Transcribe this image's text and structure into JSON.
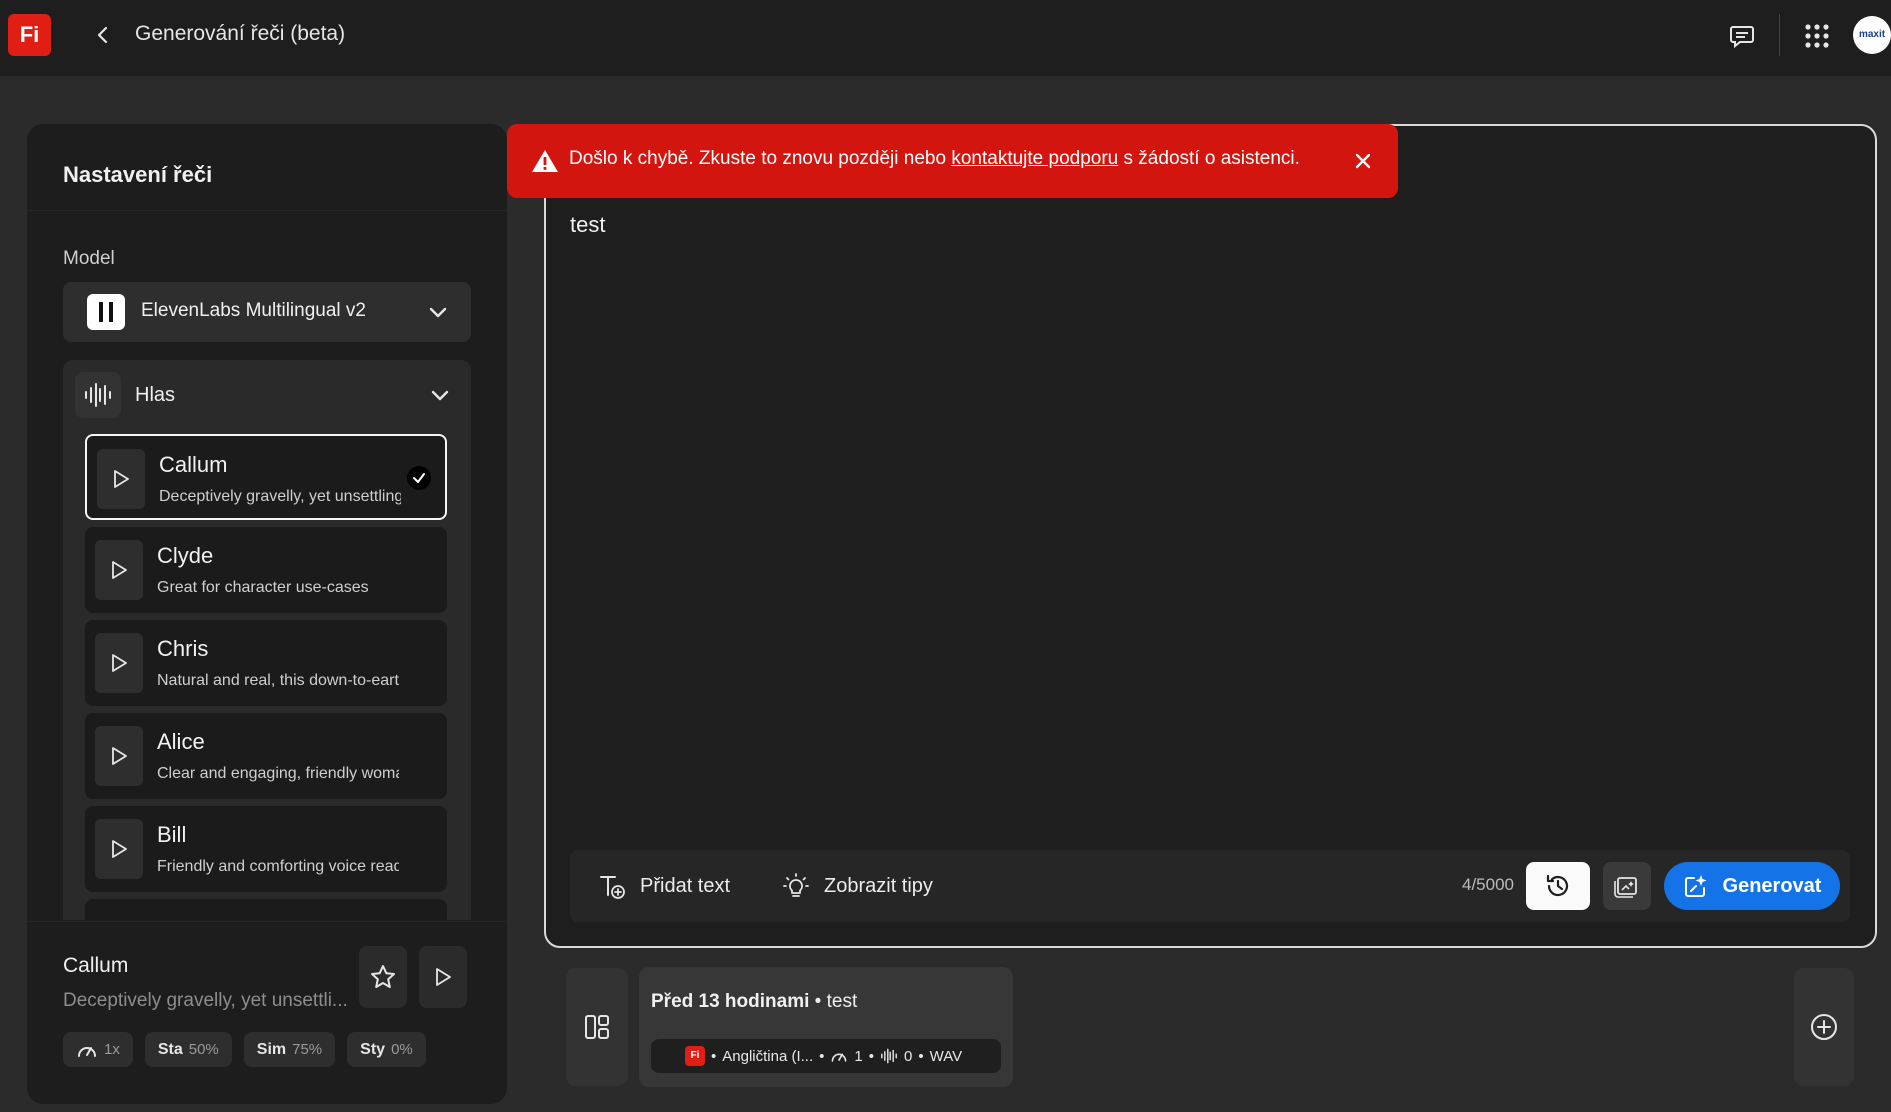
{
  "app": {
    "logo_text": "Fi",
    "title": "Generování řeči (beta)",
    "avatar_text": "maxit"
  },
  "left_panel": {
    "title": "Nastavení řeči",
    "model_label": "Model",
    "model_value": "ElevenLabs Multilingual v2",
    "voice_section_label": "Hlas",
    "voices": [
      {
        "name": "Callum",
        "desc": "Deceptively gravelly, yet unsettling",
        "selected": true
      },
      {
        "name": "Clyde",
        "desc": "Great for character use-cases",
        "selected": false
      },
      {
        "name": "Chris",
        "desc": "Natural and real, this down-to-earth voice",
        "selected": false
      },
      {
        "name": "Alice",
        "desc": "Clear and engaging, friendly woman with",
        "selected": false
      },
      {
        "name": "Bill",
        "desc": "Friendly and comforting voice ready to",
        "selected": false
      }
    ],
    "selected": {
      "name": "Callum",
      "desc": "Deceptively gravelly, yet unsettli...",
      "chips": [
        {
          "label": "",
          "value": "1x",
          "icon": "speed-icon"
        },
        {
          "label": "Sta",
          "value": "50%"
        },
        {
          "label": "Sim",
          "value": "75%"
        },
        {
          "label": "Sty",
          "value": "0%"
        }
      ]
    }
  },
  "error": {
    "before": "Došlo k chybě. Zkuste to znovu později nebo ",
    "link": "kontaktujte podporu",
    "after": " s žádostí o asistenci."
  },
  "editor": {
    "text": "test",
    "add_text_label": "Přidat text",
    "tips_label": "Zobrazit tipy",
    "counter": "4/5000",
    "generate_label": "Generovat"
  },
  "history": {
    "time": "Před 13 hodinami",
    "sep": " • ",
    "text": "test",
    "meta_language": "Angličtina (I...",
    "meta_speed": "1",
    "meta_count": "0",
    "meta_format": "WAV",
    "dot": "•"
  },
  "colors": {
    "accent": "#1473e6",
    "error": "#d31510",
    "brand": "#e01e14"
  }
}
